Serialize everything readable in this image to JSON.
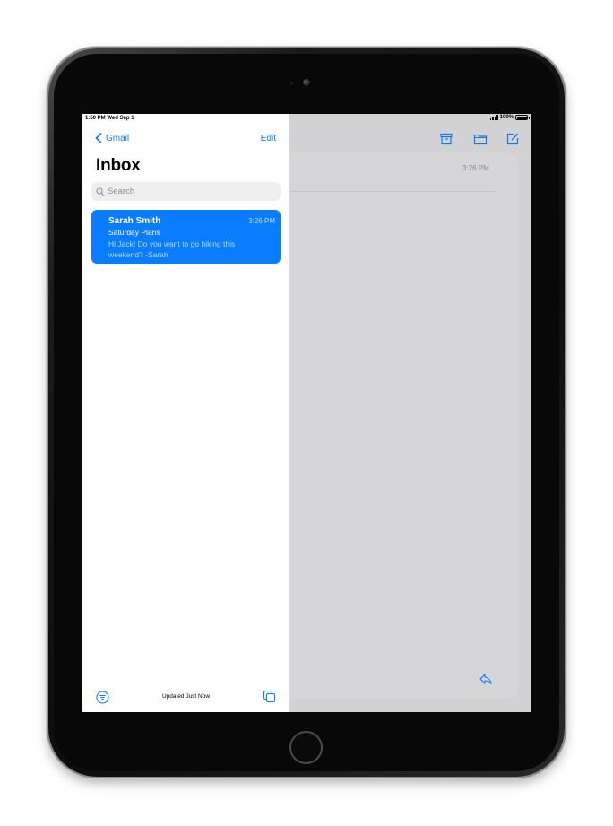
{
  "status": {
    "time_date": "1:50 PM  Wed Sep 1",
    "battery": "100%"
  },
  "sidebar": {
    "back_label": "Gmail",
    "edit_label": "Edit",
    "title": "Inbox",
    "search_placeholder": "Search",
    "messages": [
      {
        "sender": "Sarah Smith",
        "time": "3:26 PM",
        "subject": "Saturday Plans",
        "preview": "Hi Jack! Do you want to go hiking this weekend? -Sarah"
      }
    ],
    "footer_status": "Updated Just Now"
  },
  "detail": {
    "time": "3:26 PM"
  },
  "colors": {
    "accent": "#0a7cff",
    "detail_bg": "#d2d2d4"
  },
  "icons": [
    "chevron-left-icon",
    "search-icon",
    "archive-icon",
    "folder-icon",
    "compose-icon",
    "reply-icon",
    "filter-icon",
    "stack-icon",
    "signal-icon",
    "battery-icon"
  ]
}
